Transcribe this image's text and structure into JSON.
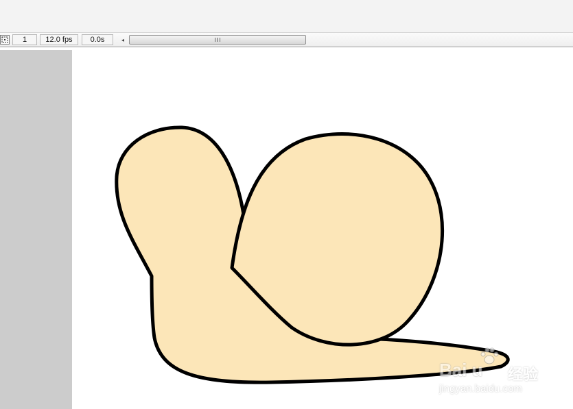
{
  "timeline": {
    "current_frame": "1",
    "frame_rate": "12.0 fps",
    "elapsed_time": "0.0s",
    "scroll_left_glyph": "◂",
    "center_frame_icon": "center-frame-icon"
  },
  "stage": {
    "background": "#ffffff",
    "pasteboard_color": "#cccccc",
    "shape_fill": "#fce6b8",
    "shape_stroke": "#000000"
  },
  "watermark": {
    "logo_text": "Bai  u",
    "logo_suffix": "经验",
    "url": "jingyan.baidu.com"
  }
}
